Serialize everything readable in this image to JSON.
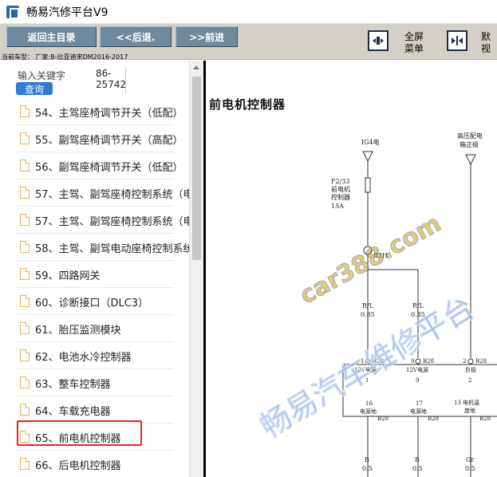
{
  "window": {
    "title": "畅易汽修平台V9",
    "icon": "app-logo-icon"
  },
  "toolbar": {
    "home_label": "返回主目录",
    "back_label": "<<后退.",
    "forward_label": ">>前进",
    "fullscreen_label_line1": "全屏",
    "fullscreen_label_line2": "菜单",
    "default_label_line1": "默",
    "default_label_line2": "视",
    "fullscreen_icon": "expand-arrows-icon",
    "default_icon": "collapse-arrows-icon",
    "vehicle_info": "当前车型：  厂家:B-比亚迪宋DM2016-2017"
  },
  "sidebar": {
    "search_label": "输入关键字",
    "search_code": "86-25742",
    "search_button": "查询",
    "items": [
      {
        "label": "54、主驾座椅调节开关（低配）"
      },
      {
        "label": "55、副驾座椅调节开关（高配）"
      },
      {
        "label": "56、副驾座椅调节开关（低配）"
      },
      {
        "label": "57、主驾、副驾座椅控制系统（电"
      },
      {
        "label": "57、主驾、副驾座椅控制系统（电"
      },
      {
        "label": "58、主驾、副驾电动座椅控制系统"
      },
      {
        "label": "59、四路网关"
      },
      {
        "label": "60、诊断接口（DLC3）"
      },
      {
        "label": "61、胎压监测模块"
      },
      {
        "label": "62、电池水冷控制器"
      },
      {
        "label": "63、整车控制器"
      },
      {
        "label": "64、车载充电器"
      },
      {
        "label": "65、前电机控制器"
      },
      {
        "label": "66、后电机控制器"
      }
    ],
    "selected_index": 12,
    "highlight_color": "#e0262b"
  },
  "diagram": {
    "title": "前电机控制器",
    "labels": {
      "ig4": "IG4电",
      "hv_line1": "高压配电",
      "hv_line2": "箱正极",
      "fuse_line1": "F2/33",
      "fuse_line2": "前电机",
      "fuse_line3": "控制器",
      "fuse_line4": "15A",
      "conn_b2h": "B2H",
      "wire1_color": "R/L",
      "wire1_gauge": "0.85",
      "wire2_color": "R/L",
      "wire2_gauge": "0.85",
      "pin1": "1",
      "pin1_conn": "B28",
      "pin1_name": "12V电源",
      "pin1_no": "1",
      "pin9": "9",
      "pin9_conn": "B28",
      "pin9_name": "12V电源",
      "pin9_no": "9",
      "pin2": "2",
      "pin2_conn": "B28",
      "pin2_name": "负极",
      "pin2_no": "2",
      "pin16": "16",
      "pin16_name": "电源地",
      "pin16_conn": "B28",
      "pin17": "17",
      "pin17_name": "电源地",
      "pin17_conn": "B28",
      "pin13": "13",
      "pin13_name_line1": "电机温",
      "pin13_name_line2": "度地",
      "pin13_conn": "B28",
      "gnd1_color": "B",
      "gnd1_gauge": "0.5",
      "gnd2_color": "B",
      "gnd2_gauge": "0.5",
      "gnd3_color": "Gr",
      "gnd3_gauge": "0.5"
    },
    "watermark_url": "car388.com",
    "watermark_brand": "畅易汽车维修平台"
  }
}
